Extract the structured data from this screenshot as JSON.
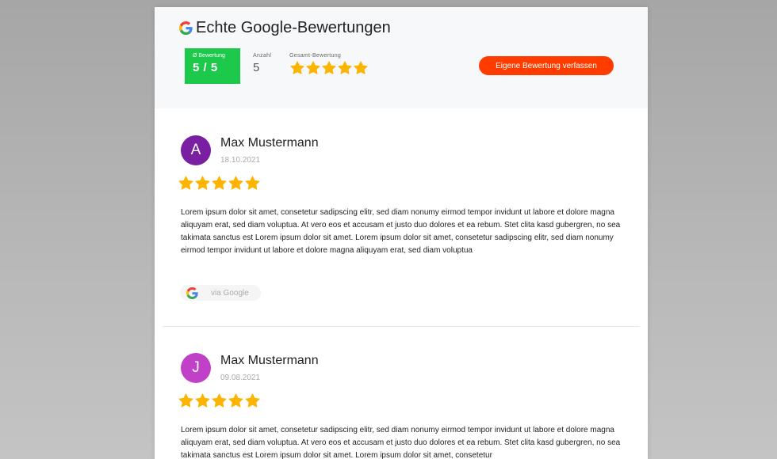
{
  "header": {
    "title": "Echte Google-Bewertungen",
    "rating_label": "Ø Bewertung",
    "rating_value": "5 / 5",
    "count_label": "Anzahl",
    "count_value": "5",
    "overall_label": "Gesamt-Bewertung",
    "overall_stars": 5,
    "write_review_label": "Eigene Bewertung verfassen"
  },
  "reviews": [
    {
      "initial": "A",
      "author": "Max Mustermann",
      "date": "18.10.2021",
      "stars": 5,
      "text": "Lorem ipsum dolor sit amet, consetetur sadipscing elitr, sed diam nonumy eirmod tempor invidunt ut labore et dolore magna aliquyam erat, sed diam voluptua. At vero eos et accusam et justo duo dolores et ea rebum. Stet clita kasd gubergren, no sea takimata sanctus est Lorem ipsum dolor sit amet. Lorem ipsum dolor sit amet, consetetur sadipscing elitr, sed diam nonumy eirmod tempor invidunt ut labore et dolore magna aliquyam erat, sed diam voluptua",
      "source_label": "via Google",
      "avatar_color": "#7b1fa2"
    },
    {
      "initial": "J",
      "author": "Max Mustermann",
      "date": "09.08.2021",
      "stars": 5,
      "text": "Lorem ipsum dolor sit amet, consetetur sadipscing elitr, sed diam nonumy eirmod tempor invidunt ut labore et dolore magna aliquyam erat, sed diam voluptua. At vero eos et accusam et justo duo dolores et ea rebum. Stet clita kasd gubergren, no sea takimata sanctus est Lorem ipsum dolor sit amet. Lorem ipsum dolor sit amet, consetetur",
      "avatar_color": "#c040c8"
    }
  ],
  "colors": {
    "rating_green": "#1cc94a",
    "button_orange": "#ff3c00",
    "star_gold": "#fdb400",
    "header_bg": "#f7f8f9"
  },
  "icons": [
    "google-icon",
    "star-icon"
  ]
}
